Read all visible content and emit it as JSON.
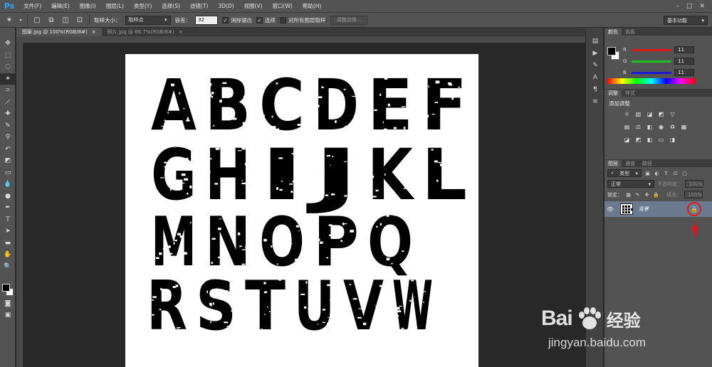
{
  "app": {
    "logo": "Ps"
  },
  "menu": [
    "文件(F)",
    "编辑(E)",
    "图像(I)",
    "图层(L)",
    "类型(Y)",
    "选择(S)",
    "滤镜(T)",
    "3D(D)",
    "视图(V)",
    "窗口(W)",
    "帮助(H)"
  ],
  "options": {
    "sample_size_label": "取样大小：",
    "sample_size_value": "取样点",
    "tolerance_label": "容差：",
    "tolerance_value": "32",
    "antialias_label": "消除锯齿",
    "antialias_checked": true,
    "contiguous_label": "连续",
    "contiguous_checked": true,
    "all_layers_label": "对所有图层取样",
    "all_layers_checked": false,
    "refine_edge_label": "调整边缘...",
    "workspace": "基本功能"
  },
  "tabs": [
    {
      "label": "图案.jpg @ 100%(RGB/8#)",
      "active": true
    },
    {
      "label": "照片.jpg @ 66.7%(RGB/8#)",
      "active": false
    }
  ],
  "document": {
    "rows": [
      "ABCDEF",
      "GHIJKL",
      "MNOPQ",
      "RSTUVW"
    ]
  },
  "color_panel": {
    "tabs": [
      "颜色",
      "色板"
    ],
    "channels": [
      {
        "label": "R",
        "value": "11"
      },
      {
        "label": "G",
        "value": "11"
      },
      {
        "label": "B",
        "value": "11"
      }
    ],
    "colors": {
      "r_bar": "#e01818",
      "g_bar": "#1ec21e",
      "b_bar": "#1a1ad8"
    }
  },
  "adjust_panel": {
    "tabs": [
      "调整",
      "样式"
    ],
    "title": "添加调整"
  },
  "layers_panel": {
    "tabs": [
      "图层",
      "通道",
      "路径"
    ],
    "filter_label": "类型",
    "blend_mode": "正常",
    "opacity_label": "不透明度：",
    "opacity_value": "100%",
    "lock_label": "锁定：",
    "fill_label": "填充：",
    "fill_value": "100%",
    "layer_name": "背景"
  },
  "watermark": {
    "bai": "Bai",
    "du": "du",
    "jingyan": "经验",
    "url": "jingyan.baidu.com"
  }
}
